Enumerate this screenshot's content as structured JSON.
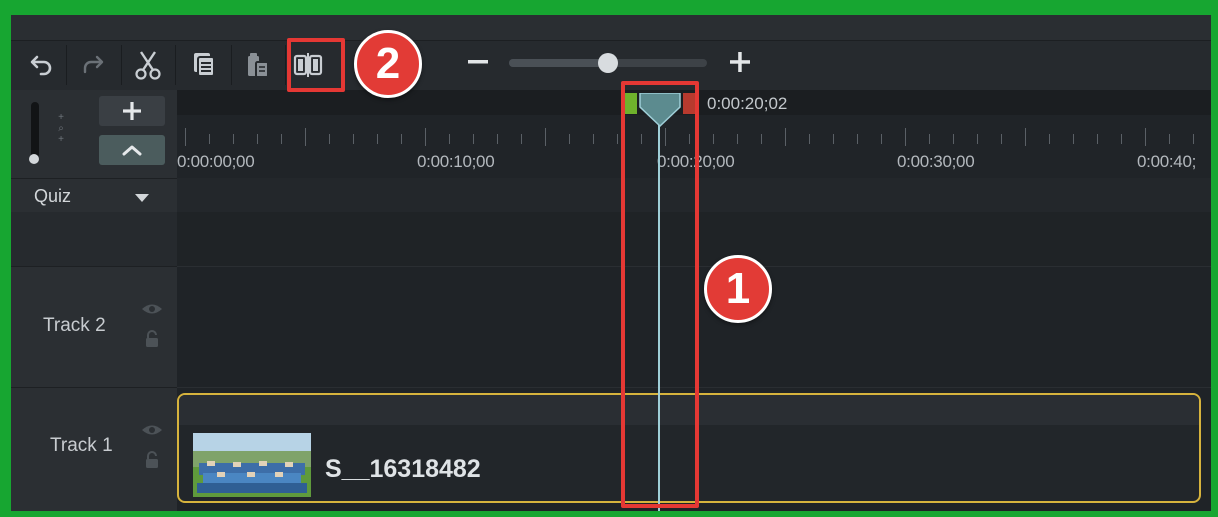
{
  "toolbar": {
    "buttons": [
      "undo-icon",
      "redo-icon",
      "cut-icon",
      "copy-icon",
      "paste-icon",
      "split-icon"
    ],
    "zoom": {
      "minus_label": "−",
      "plus_label": "+",
      "level": 0.5
    }
  },
  "left_panel": {
    "add_track_label": "+",
    "collapse_label": "^",
    "quiz": {
      "label": "Quiz"
    },
    "tracks": [
      {
        "name": "Track 2"
      },
      {
        "name": "Track 1"
      }
    ]
  },
  "ruler": {
    "ticks": [
      "0:00:00;00",
      "0:00:10;00",
      "0:00:20;00",
      "0:00:30;00",
      "0:00:40;"
    ],
    "playhead_time": "0:00:20;02"
  },
  "clip": {
    "name": "S__16318482"
  },
  "annotations": {
    "badge_1": "1",
    "badge_2": "2",
    "color": "#e53834"
  },
  "colors": {
    "frame": "#17a631",
    "clip_border": "#d6b33d",
    "playhead": "#5a8a8e"
  }
}
